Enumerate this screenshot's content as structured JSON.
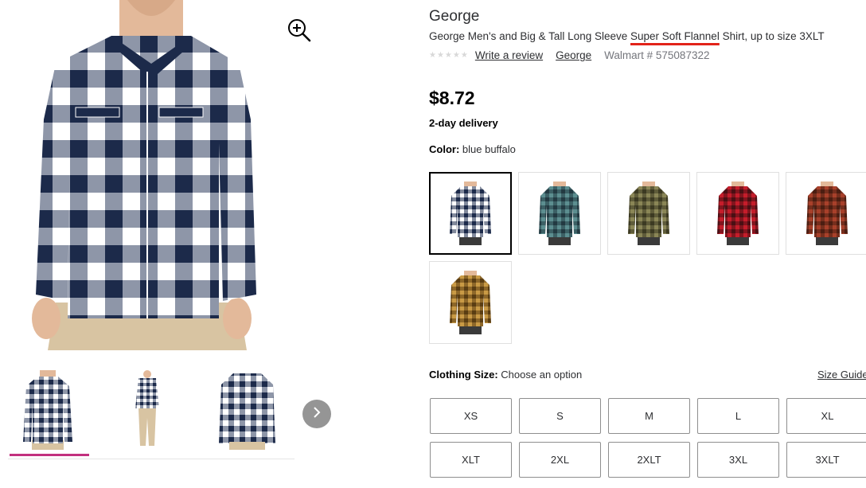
{
  "product": {
    "brand": "George",
    "title_before": "George Men's and Big & Tall Long Sleeve ",
    "title_highlight": "Super Soft Flannel",
    "title_after": " Shirt, up to size 3XLT",
    "stars_glyphs": "★★★★★",
    "write_review_label": "Write a review",
    "brand_link_label": "George",
    "item_number": "Walmart # 575087322",
    "price": "$8.72",
    "delivery": "2-day delivery",
    "color_label": "Color:",
    "color_value": "blue buffalo",
    "size_label": "Clothing Size:",
    "size_value": "Choose an option",
    "size_guide_label": "Size Guide"
  },
  "gallery": {
    "zoom_icon": "zoom-in-icon",
    "next_icon": "chevron-right-icon",
    "active_thumb_index": 0,
    "underline_color": "#c2307e"
  },
  "swatches": [
    {
      "name": "blue buffalo",
      "dark": "#1c2a4a",
      "light": "#ffffff",
      "selected": true
    },
    {
      "name": "teal plaid",
      "dark": "#233a42",
      "light": "#5c8e90",
      "selected": false
    },
    {
      "name": "olive plaid",
      "dark": "#3c3a22",
      "light": "#8a8656",
      "selected": false
    },
    {
      "name": "red buffalo",
      "dark": "#4a0f14",
      "light": "#c51d2a",
      "selected": false
    },
    {
      "name": "rust plaid",
      "dark": "#4b1e12",
      "light": "#a8402a",
      "selected": false
    },
    {
      "name": "gold plaid",
      "dark": "#5a3d12",
      "light": "#c99a45",
      "selected": false
    }
  ],
  "sizes": [
    "XS",
    "S",
    "M",
    "L",
    "XL",
    "XLT",
    "2XL",
    "2XLT",
    "3XL",
    "3XLT"
  ],
  "colors": {
    "accent_underline": "#e2231a",
    "shirt_navy": "#1c2a4a",
    "pants_khaki": "#d8c4a2"
  }
}
